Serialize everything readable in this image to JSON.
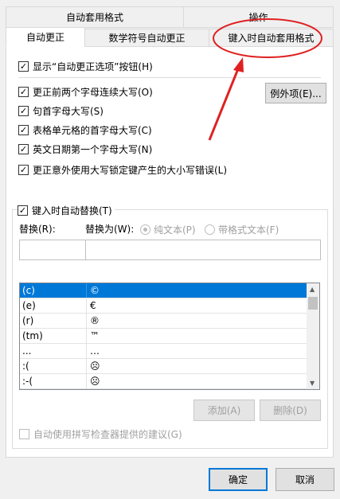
{
  "top_tabs": [
    "自动套用格式",
    "操作"
  ],
  "sub_tabs": [
    "自动更正",
    "数学符号自动更正",
    "键入时自动套用格式"
  ],
  "options": {
    "show_buttons": "显示“自动更正选项”按钮(H)",
    "items": [
      "更正前两个字母连续大写(O)",
      "句首字母大写(S)",
      "表格单元格的首字母大写(C)",
      "英文日期第一个字母大写(N)",
      "更正意外使用大写锁定键产生的大小写错误(L)"
    ],
    "check_glyph": "✓"
  },
  "exceptions_button": "例外项(E)...",
  "replace_section": {
    "checkbox_label": "键入时自动替换(T)",
    "replace_label": "替换(R):",
    "with_label": "替换为(W):",
    "plain_text": "纯文本(P)",
    "formatted_text": "带格式文本(F)",
    "replace_value": "",
    "with_value": ""
  },
  "replacements": [
    {
      "from": "(c)",
      "to": "©"
    },
    {
      "from": "(e)",
      "to": "€"
    },
    {
      "from": "(r)",
      "to": "®"
    },
    {
      "from": "(tm)",
      "to": "™"
    },
    {
      "from": "...",
      "to": "…"
    },
    {
      "from": ":(",
      "to": "☹"
    },
    {
      "from": ":-(",
      "to": "☹"
    }
  ],
  "add_button": "添加(A)",
  "delete_button": "删除(D)",
  "spellcheck_label": "自动使用拼写检查器提供的建议(G)",
  "ok_button": "确定",
  "cancel_button": "取消",
  "annotation_color": "#e02020"
}
